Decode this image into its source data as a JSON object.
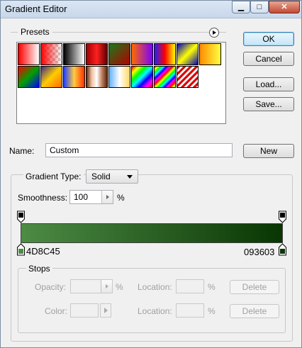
{
  "window": {
    "title": "Gradient Editor"
  },
  "title_buttons": [
    {
      "name": "minimize-button",
      "glyph": "▁"
    },
    {
      "name": "maximize-button",
      "glyph": "□"
    },
    {
      "name": "close-button",
      "glyph": "✕"
    }
  ],
  "presets": {
    "label": "Presets",
    "menu_icon": "play-circle-icon",
    "swatches": [
      {
        "css": "linear-gradient(to right,#ff0000,#ffffff)"
      },
      {
        "css": "linear-gradient(to right,rgba(255,0,0,1),rgba(255,0,0,0)), repeating-conic-gradient(#ccc 0 25%,#fff 0 50%) 0 0/8px 8px"
      },
      {
        "css": "linear-gradient(to right,#000000,#ffffff)"
      },
      {
        "css": "linear-gradient(to right,#a00000,#ff2020,#600000)"
      },
      {
        "css": "linear-gradient(135deg,#1a7a1a,#b30000)"
      },
      {
        "css": "linear-gradient(to right,#ff6a00,#7a00ff)"
      },
      {
        "css": "linear-gradient(to right,#2020ff,#ff0000,#ffff00)"
      },
      {
        "css": "linear-gradient(135deg,#0000c0,#ffff00,#0000c0)"
      },
      {
        "css": "linear-gradient(to right,#ff8c00,#ffff40)"
      },
      {
        "css": "linear-gradient(135deg,#ff0000,#00a000,#0000ff)"
      },
      {
        "css": "linear-gradient(135deg,#3a2a8a,#ffcc00,#ff6a00)"
      },
      {
        "css": "linear-gradient(to right,#2040ff,#ffcc40,#ff3000)"
      },
      {
        "css": "linear-gradient(to right,#5a2a10,#f0c0a0,#ffffff,#c08060,#5a2a10)"
      },
      {
        "css": "linear-gradient(to right,#60b0ff,#ffffff,#ffd860)"
      },
      {
        "css": "linear-gradient(135deg,#ff0000,#ffff00,#00ff00,#00ffff,#0000ff,#ff00ff,#ff0000)"
      },
      {
        "css": "repeating-linear-gradient(135deg,#ff0000 0,#ffff00 3px,#00ff00 6px,#00ffff 9px,#0000ff 12px,#ff00ff 15px,#ff0000 18px)"
      },
      {
        "css": "repeating-linear-gradient(135deg,#e00000 0 3px,#ffffff 3px 6px)"
      }
    ]
  },
  "buttons": {
    "ok": "OK",
    "cancel": "Cancel",
    "load": "Load...",
    "save": "Save...",
    "new": "New"
  },
  "name": {
    "label": "Name:",
    "value": "Custom"
  },
  "gradient_type": {
    "label": "Gradient Type:",
    "value": "Solid"
  },
  "smoothness": {
    "label": "Smoothness:",
    "value": "100",
    "unit": "%"
  },
  "gradient": {
    "start_color": "#4D8C45",
    "end_color": "#093603",
    "start_label": "4D8C45",
    "end_label": "093603"
  },
  "stops": {
    "label": "Stops",
    "opacity_label": "Opacity:",
    "opacity_unit": "%",
    "location_label": "Location:",
    "location_unit": "%",
    "color_label": "Color:",
    "delete_label": "Delete"
  }
}
